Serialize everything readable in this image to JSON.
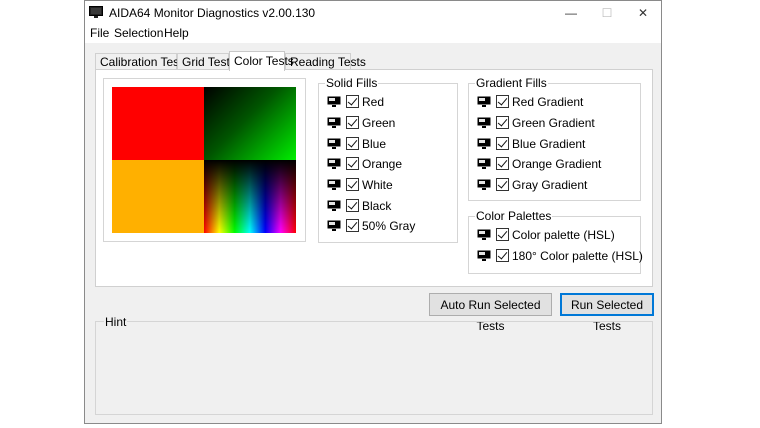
{
  "window": {
    "title": "AIDA64 Monitor Diagnostics v2.00.130",
    "controls": [
      "—",
      "☐",
      "✕"
    ]
  },
  "menu": [
    "File",
    "Selection",
    "Help"
  ],
  "tabs": [
    "Calibration Tests",
    "Grid Tests",
    "Color Tests",
    "Reading Tests"
  ],
  "active_tab": "Color Tests",
  "solid_fills": {
    "title": "Solid Fills",
    "items": [
      {
        "label": "Red",
        "checked": true
      },
      {
        "label": "Green",
        "checked": true
      },
      {
        "label": "Blue",
        "checked": true
      },
      {
        "label": "Orange",
        "checked": true
      },
      {
        "label": "White",
        "checked": true
      },
      {
        "label": "Black",
        "checked": true
      },
      {
        "label": "50% Gray",
        "checked": true
      }
    ]
  },
  "gradient_fills": {
    "title": "Gradient Fills",
    "items": [
      {
        "label": "Red Gradient",
        "checked": true
      },
      {
        "label": "Green Gradient",
        "checked": true
      },
      {
        "label": "Blue Gradient",
        "checked": true
      },
      {
        "label": "Orange Gradient",
        "checked": true
      },
      {
        "label": "Gray Gradient",
        "checked": true
      }
    ]
  },
  "color_palettes": {
    "title": "Color Palettes",
    "items": [
      {
        "label": "Color palette (HSL)",
        "checked": true
      },
      {
        "label": "180° Color palette (HSL)",
        "checked": true
      }
    ]
  },
  "buttons": {
    "auto_run": "Auto Run Selected Tests",
    "run": "Run Selected Tests"
  },
  "hint": {
    "title": "Hint"
  },
  "colors": {
    "red": "#ff0000",
    "orange": "#ffb000",
    "green": "#00dd00",
    "accent": "#0078d7"
  }
}
